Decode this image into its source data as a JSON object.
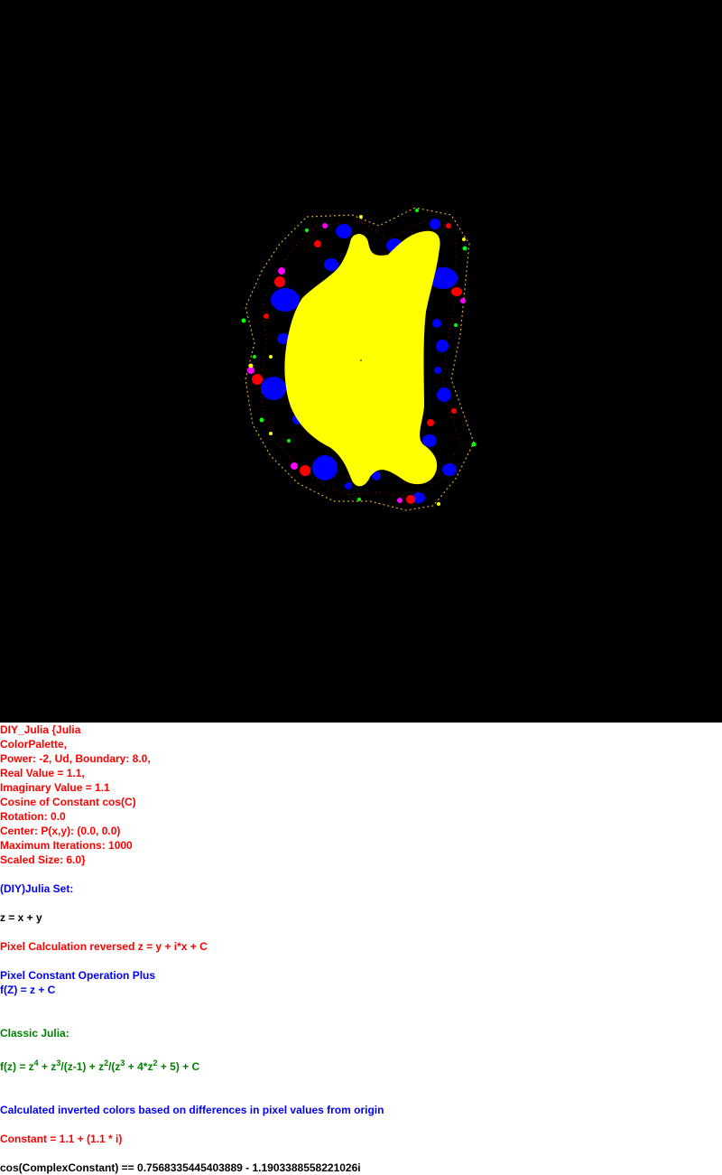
{
  "fractal": {
    "colors": {
      "background": "#000000",
      "interior": "#ffff00",
      "bulbs": "#0000ff",
      "accent_red": "#ff0000",
      "accent_magenta": "#ff00ff",
      "accent_green": "#00ff00"
    }
  },
  "params": {
    "line1": "DIY_Julia {Julia",
    "line2": "ColorPalette,",
    "line3": "Power: -2, Ud, Boundary: 8.0,",
    "line4": "Real Value = 1.1,",
    "line5": "Imaginary Value = 1.1",
    "line6": "Cosine of Constant cos(C)",
    "line7": "Rotation: 0.0",
    "line8": "Center: P(x,y): (0.0, 0.0)",
    "line9": "Maximum Iterations: 1000",
    "line10": "Scaled Size: 6.0}"
  },
  "set_title": "(DIY)Julia Set:",
  "z_def": "z = x + y",
  "pixel_calc": "Pixel Calculation reversed z = y + i*x + C",
  "pixel_op": "Pixel Constant Operation Plus",
  "fz": "f(Z) = z + C",
  "classic": "Classic Julia:",
  "formula": {
    "p1": "f(z) = z",
    "e1": "4",
    "p2": " + z",
    "e2": "3",
    "p3": "/(z-1) + z",
    "e3": "2",
    "p4": "/(z",
    "e4": "3",
    "p5": " + 4*z",
    "e5": "2",
    "p6": " + 5) + C"
  },
  "colors_note": "Calculated inverted colors based on differences in pixel values from origin",
  "constant": "Constant = 1.1 + (1.1 * i)",
  "cos_line": "cos(ComplexConstant) == 0.7568335445403889 - 1.1903388558221026i"
}
